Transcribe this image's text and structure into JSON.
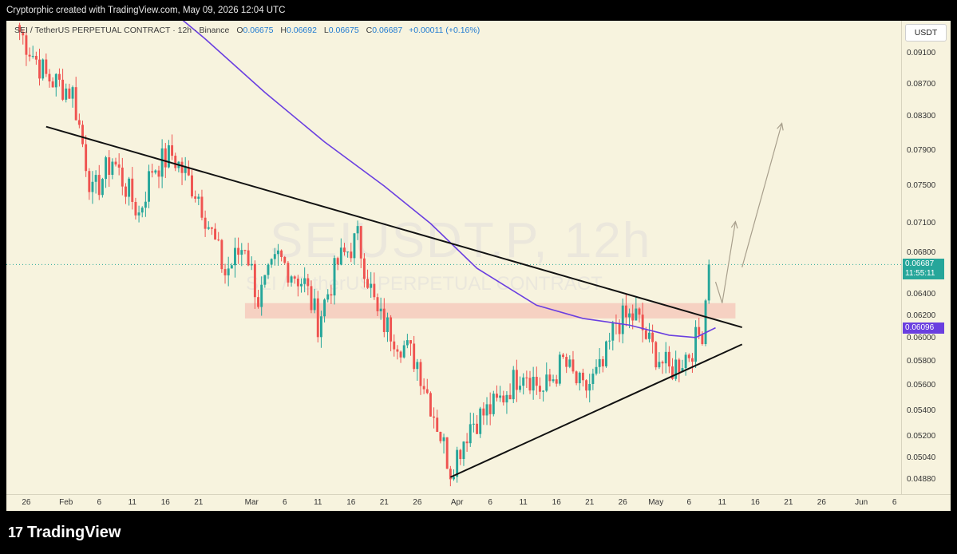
{
  "header": {
    "credit": "Cryptorphic created with TradingView.com, May 09, 2026 12:04 UTC"
  },
  "legend": {
    "symbol": "SEI / TetherUS PERPETUAL CONTRACT · 12h · Binance",
    "o_label": "O",
    "o": "0.06675",
    "h_label": "H",
    "h": "0.06692",
    "l_label": "L",
    "l": "0.06675",
    "c_label": "C",
    "c": "0.06687",
    "change": "+0.00011 (+0.16%)"
  },
  "watermark": {
    "line1": "SEIUSDT.P, 12h",
    "line2": "SEI / TetherUS PERPETUAL CONTRACT"
  },
  "axis": {
    "currency": "USDT",
    "price_ticks": [
      "0.09100",
      "0.08700",
      "0.08300",
      "0.07900",
      "0.07500",
      "0.07100",
      "0.06800",
      "0.06400",
      "0.06200",
      "0.06000",
      "0.05800",
      "0.05600",
      "0.05400",
      "0.05200",
      "0.05040",
      "0.04880"
    ],
    "date_ticks": [
      "26",
      "Feb",
      "6",
      "11",
      "16",
      "21",
      "Mar",
      "6",
      "11",
      "16",
      "21",
      "26",
      "Apr",
      "6",
      "11",
      "16",
      "21",
      "26",
      "May",
      "6",
      "11",
      "16",
      "21",
      "26",
      "Jun",
      "6"
    ]
  },
  "price_labels": {
    "last": "0.06687",
    "countdown": "11:55:11",
    "ma": "0.06096"
  },
  "colors": {
    "up": "#26a69a",
    "down": "#ef5350",
    "ma": "#6a3fe0",
    "background": "#f7f3de",
    "zone": "#f5c6b8"
  },
  "footer": {
    "brand": "TradingView",
    "brand_mark": "17"
  },
  "chart_data": {
    "type": "candlestick",
    "title": "SEI / TetherUS PERPETUAL CONTRACT · 12h · Binance",
    "interval": "12h",
    "y_scale": "log",
    "ylim": [
      0.0478,
      0.0955
    ],
    "xlim": [
      "2026-01-23",
      "2026-06-07"
    ],
    "ohlc_summary": {
      "open": 0.06675,
      "high": 0.06692,
      "low": 0.06675,
      "close": 0.06687
    },
    "key_points": [
      {
        "date": "2026-01-25",
        "close": 0.094
      },
      {
        "date": "2026-01-29",
        "close": 0.088
      },
      {
        "date": "2026-02-02",
        "close": 0.086
      },
      {
        "date": "2026-02-05",
        "close": 0.074
      },
      {
        "date": "2026-02-08",
        "close": 0.078
      },
      {
        "date": "2026-02-12",
        "close": 0.072
      },
      {
        "date": "2026-02-14",
        "close": 0.077
      },
      {
        "date": "2026-02-17",
        "close": 0.0785
      },
      {
        "date": "2026-02-21",
        "close": 0.074
      },
      {
        "date": "2026-02-25",
        "close": 0.066
      },
      {
        "date": "2026-02-28",
        "close": 0.069
      },
      {
        "date": "2026-03-02",
        "close": 0.0635
      },
      {
        "date": "2026-03-05",
        "close": 0.0675
      },
      {
        "date": "2026-03-09",
        "close": 0.065
      },
      {
        "date": "2026-03-11",
        "close": 0.0615
      },
      {
        "date": "2026-03-14",
        "close": 0.067
      },
      {
        "date": "2026-03-17",
        "close": 0.0695
      },
      {
        "date": "2026-03-20",
        "close": 0.062
      },
      {
        "date": "2026-03-23",
        "close": 0.06
      },
      {
        "date": "2026-03-26",
        "close": 0.058
      },
      {
        "date": "2026-03-29",
        "close": 0.053
      },
      {
        "date": "2026-03-31",
        "close": 0.0496
      },
      {
        "date": "2026-04-03",
        "close": 0.053
      },
      {
        "date": "2026-04-07",
        "close": 0.0545
      },
      {
        "date": "2026-04-11",
        "close": 0.0575
      },
      {
        "date": "2026-04-14",
        "close": 0.0555
      },
      {
        "date": "2026-04-17",
        "close": 0.058
      },
      {
        "date": "2026-04-20",
        "close": 0.0555
      },
      {
        "date": "2026-04-23",
        "close": 0.0575
      },
      {
        "date": "2026-04-25",
        "close": 0.0615
      },
      {
        "date": "2026-04-28",
        "close": 0.062
      },
      {
        "date": "2026-04-30",
        "close": 0.0595
      },
      {
        "date": "2026-05-03",
        "close": 0.0572
      },
      {
        "date": "2026-05-06",
        "close": 0.0588
      },
      {
        "date": "2026-05-08",
        "close": 0.0608
      },
      {
        "date": "2026-05-09",
        "close": 0.06687
      }
    ],
    "moving_average": {
      "line_color": "#6a3fe0",
      "points": [
        {
          "date": "2026-02-13",
          "value": 0.1
        },
        {
          "date": "2026-02-22",
          "value": 0.093
        },
        {
          "date": "2026-03-03",
          "value": 0.086
        },
        {
          "date": "2026-03-12",
          "value": 0.08
        },
        {
          "date": "2026-03-21",
          "value": 0.075
        },
        {
          "date": "2026-03-28",
          "value": 0.071
        },
        {
          "date": "2026-04-04",
          "value": 0.0665
        },
        {
          "date": "2026-04-13",
          "value": 0.063
        },
        {
          "date": "2026-04-20",
          "value": 0.0618
        },
        {
          "date": "2026-04-27",
          "value": 0.0612
        },
        {
          "date": "2026-05-03",
          "value": 0.0603
        },
        {
          "date": "2026-05-07",
          "value": 0.0601
        },
        {
          "date": "2026-05-10",
          "value": 0.06096
        }
      ]
    },
    "trendlines": [
      {
        "start": {
          "date": "2026-01-29",
          "price": 0.0818
        },
        "end": {
          "date": "2026-05-14",
          "price": 0.061
        }
      },
      {
        "start": {
          "date": "2026-03-31",
          "price": 0.049
        },
        "end": {
          "date": "2026-05-14",
          "price": 0.0595
        }
      }
    ],
    "zone": {
      "price_low": 0.0618,
      "price_high": 0.0632,
      "date_start": "2026-02-28",
      "date_end": "2026-05-13"
    },
    "arrows": [
      {
        "points": [
          {
            "date": "2026-05-10",
            "price": 0.0652
          },
          {
            "date": "2026-05-11",
            "price": 0.0632
          },
          {
            "date": "2026-05-13",
            "price": 0.0712
          }
        ]
      },
      {
        "points": [
          {
            "date": "2026-05-14",
            "price": 0.0666
          },
          {
            "date": "2026-05-20",
            "price": 0.0822
          }
        ]
      }
    ],
    "last_price_line": 0.06687
  }
}
